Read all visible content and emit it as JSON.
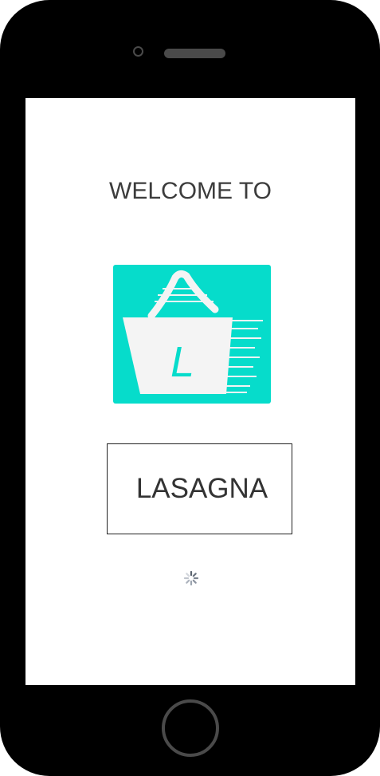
{
  "screen": {
    "welcome_text": "WELCOME TO",
    "logo": {
      "icon": "shopping-basket-icon",
      "letter": "L",
      "background_color": "#06dccb",
      "basket_color": "#f4f4f4"
    },
    "app_name": "LASAGNA",
    "loading_indicator": "spinner-icon"
  },
  "device": {
    "frame_color": "#000000",
    "accent_color": "#4a4a4a"
  }
}
